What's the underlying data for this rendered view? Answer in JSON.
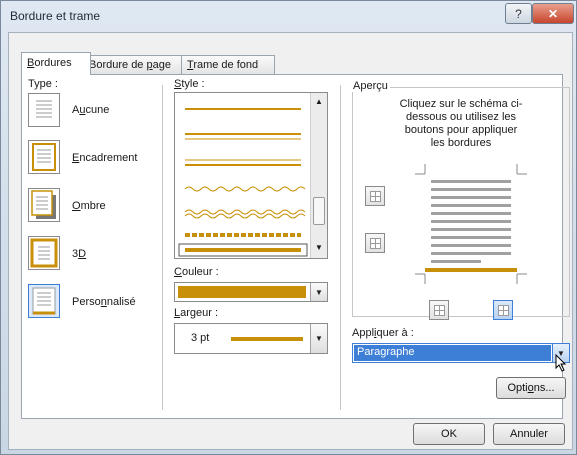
{
  "window": {
    "title": "Bordure et trame",
    "help_label": "?",
    "close_label": "✕"
  },
  "tabs": [
    {
      "label": "Bordures",
      "active": true
    },
    {
      "label": "Bordure de page",
      "active": false
    },
    {
      "label": "Trame de fond",
      "active": false
    }
  ],
  "type_section": {
    "label": "Type :",
    "items": [
      {
        "label": "Aucune",
        "icon": "border-none-icon"
      },
      {
        "label": "Encadrement",
        "icon": "border-box-icon"
      },
      {
        "label": "Ombre",
        "icon": "border-shadow-icon"
      },
      {
        "label": "3D",
        "icon": "border-3d-icon"
      },
      {
        "label": "Personnalisé",
        "icon": "border-custom-icon"
      }
    ]
  },
  "style_section": {
    "label": "Style :"
  },
  "color_section": {
    "label": "Couleur :",
    "value_color": "#c8900a"
  },
  "width_section": {
    "label": "Largeur :",
    "value": "3 pt"
  },
  "preview_section": {
    "label": "Aperçu",
    "instructions": "Cliquez sur le schéma ci-dessous ou utilisez les boutons pour appliquer les bordures"
  },
  "apply_section": {
    "label": "Appliquer à :",
    "value": "Paragraphe"
  },
  "buttons": {
    "options": "Options...",
    "ok": "OK",
    "cancel": "Annuler"
  },
  "colors": {
    "accent": "#c8900a",
    "selection": "#3d7ed6"
  }
}
